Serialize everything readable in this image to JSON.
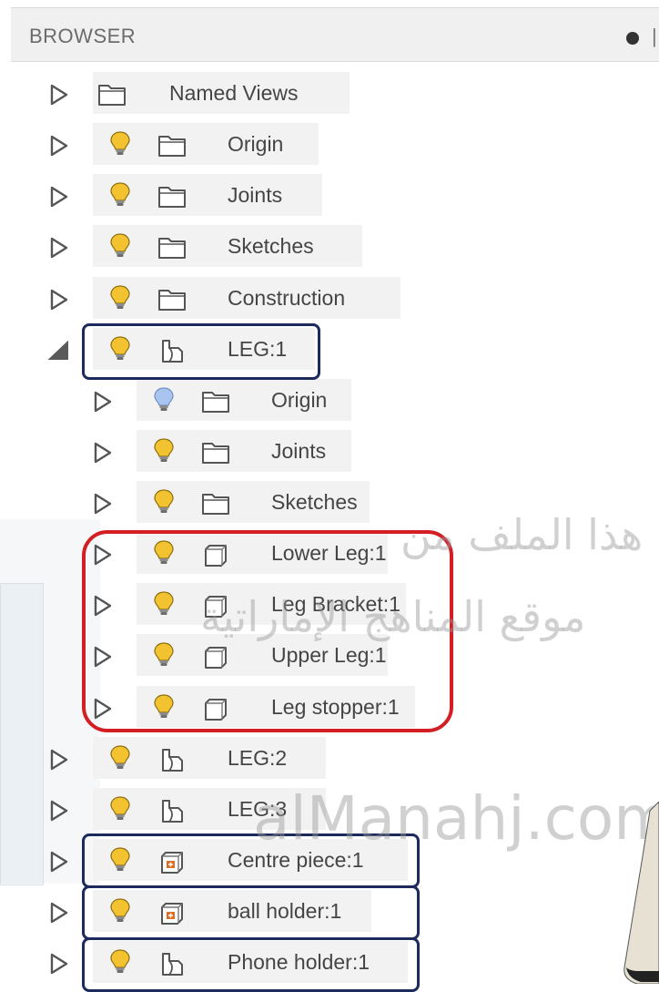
{
  "header": {
    "title": "BROWSER",
    "cut_text": "|"
  },
  "tree": [
    {
      "label": "Named Views",
      "expander": "collapsed",
      "bulb": "none",
      "icon": "folder"
    },
    {
      "label": "Origin",
      "expander": "collapsed",
      "bulb": "yellow",
      "icon": "folder"
    },
    {
      "label": "Joints",
      "expander": "collapsed",
      "bulb": "yellow",
      "icon": "folder"
    },
    {
      "label": "Sketches",
      "expander": "collapsed",
      "bulb": "yellow",
      "icon": "folder"
    },
    {
      "label": "Construction",
      "expander": "collapsed",
      "bulb": "yellow",
      "icon": "folder"
    },
    {
      "label": "LEG:1",
      "expander": "expanded",
      "bulb": "yellow",
      "icon": "component"
    },
    {
      "label": "Origin",
      "expander": "collapsed",
      "bulb": "blue",
      "icon": "folder"
    },
    {
      "label": "Joints",
      "expander": "collapsed",
      "bulb": "yellow",
      "icon": "folder"
    },
    {
      "label": "Sketches",
      "expander": "collapsed",
      "bulb": "yellow",
      "icon": "folder"
    },
    {
      "label": "Lower Leg:1",
      "expander": "collapsed",
      "bulb": "yellow",
      "icon": "body"
    },
    {
      "label": "Leg Bracket:1",
      "expander": "collapsed",
      "bulb": "yellow",
      "icon": "body"
    },
    {
      "label": "Upper Leg:1",
      "expander": "collapsed",
      "bulb": "yellow",
      "icon": "body"
    },
    {
      "label": "Leg stopper:1",
      "expander": "collapsed",
      "bulb": "yellow",
      "icon": "body"
    },
    {
      "label": "LEG:2",
      "expander": "collapsed",
      "bulb": "yellow",
      "icon": "component"
    },
    {
      "label": "LEG:3",
      "expander": "collapsed",
      "bulb": "yellow",
      "icon": "component"
    },
    {
      "label": "Centre piece:1",
      "expander": "collapsed",
      "bulb": "yellow",
      "icon": "linked-body"
    },
    {
      "label": "ball holder:1",
      "expander": "collapsed",
      "bulb": "yellow",
      "icon": "linked-body"
    },
    {
      "label": "Phone holder:1",
      "expander": "collapsed",
      "bulb": "yellow",
      "icon": "component"
    }
  ],
  "watermark": {
    "line1": "تحميل هذا الملف من",
    "line2": "موقع المناهج الإماراتية",
    "line3": "alManahj.com/"
  },
  "colors": {
    "bulb_yellow": "#f2c230",
    "bulb_blue": "#a9c4ee",
    "highlight_navy": "#1c2a5c",
    "highlight_red": "#d31e24"
  }
}
